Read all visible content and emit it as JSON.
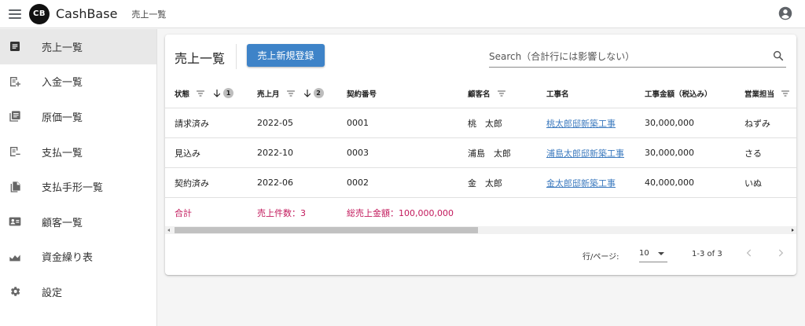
{
  "app": {
    "logo_text": "CB",
    "title": "CashBase",
    "page": "売上一覧"
  },
  "sidebar": {
    "items": [
      {
        "label": "売上一覧",
        "icon": "receipt-icon",
        "active": true
      },
      {
        "label": "入金一覧",
        "icon": "post-add-icon"
      },
      {
        "label": "原価一覧",
        "icon": "library-books-icon"
      },
      {
        "label": "支払一覧",
        "icon": "note-remove-icon"
      },
      {
        "label": "支払手形一覧",
        "icon": "file-copy-icon"
      },
      {
        "label": "顧客一覧",
        "icon": "contact-card-icon"
      },
      {
        "label": "資金繰り表",
        "icon": "area-chart-icon"
      },
      {
        "label": "設定",
        "icon": "gear-icon"
      }
    ]
  },
  "main": {
    "title": "売上一覧",
    "new_button": "売上新規登録",
    "search": {
      "placeholder": "Search（合計行には影響しない）",
      "value": ""
    },
    "table": {
      "columns": [
        "状態",
        "売上月",
        "契約番号",
        "顧客名",
        "工事名",
        "工事金額（税込み）",
        "営業担当"
      ],
      "sort_badges": [
        "1",
        "2"
      ],
      "rows": [
        [
          "請求済み",
          "2022-05",
          "0001",
          "桃　太郎",
          "桃太郎邸新築工事",
          "30,000,000",
          "ねずみ"
        ],
        [
          "見込み",
          "2022-10",
          "0003",
          "浦島　太郎",
          "浦島太郎邸新築工事",
          "30,000,000",
          "さる"
        ],
        [
          "契約済み",
          "2022-06",
          "0002",
          "金　太郎",
          "金太郎邸新築工事",
          "40,000,000",
          "いぬ"
        ]
      ],
      "total": {
        "label": "合計",
        "count": "売上件数：3",
        "sum": "総売上金額：100,000,000"
      }
    },
    "pagination": {
      "rows_label": "行/ページ:",
      "rows_value": "10",
      "range": "1-3 of 3"
    }
  },
  "colors": {
    "primary_button": "#3e83c8",
    "link": "#3e7bbf",
    "total_text": "#c2185b"
  }
}
